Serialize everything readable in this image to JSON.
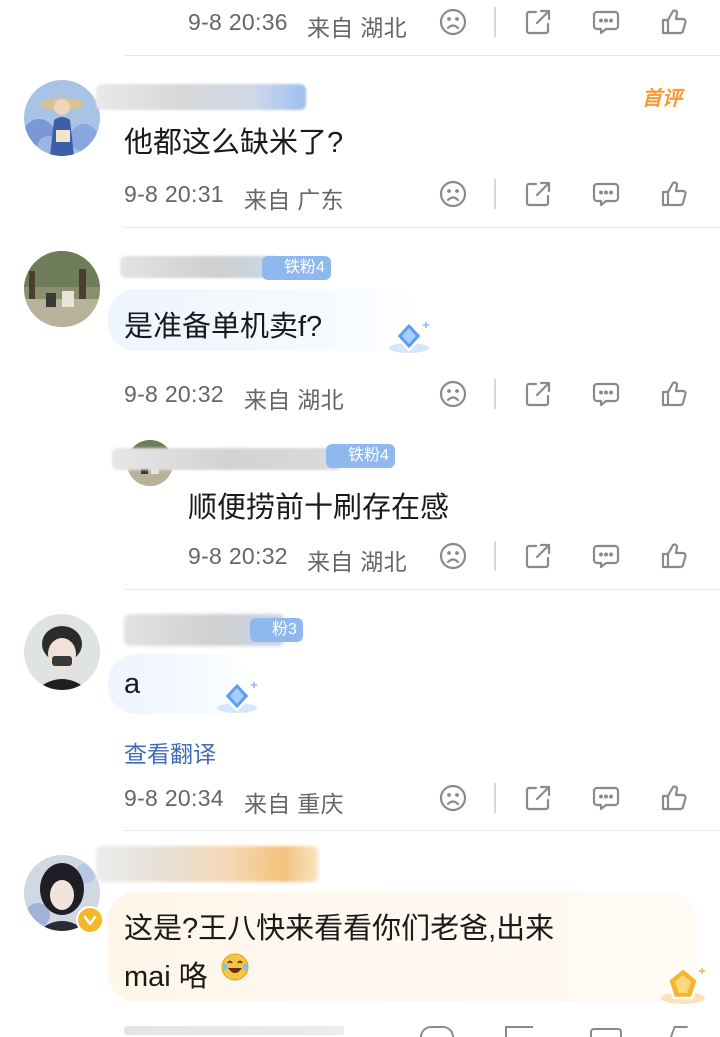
{
  "icons": {
    "dislike": "frown-face-icon",
    "share": "share-icon",
    "comment": "comment-icon",
    "like": "thumbs-up-icon"
  },
  "colors": {
    "meta_text": "#666666",
    "icon_stroke": "#8a8a8a",
    "badge_blue": "#8fb8ef",
    "first_comment_tag": "#f29b38",
    "translate_link": "#3f6eb5",
    "emoji_yellow": "#f6c343"
  },
  "top_meta": {
    "time": "9-8 20:36",
    "location": "来自 湖北"
  },
  "comments": [
    {
      "id": "c1",
      "tag": "首评",
      "text": "他都这么缺米了?",
      "time": "9-8 20:31",
      "location": "来自 广东"
    },
    {
      "id": "c2",
      "badge": "铁粉4",
      "text": "是准备单机卖f?",
      "time": "9-8 20:32",
      "location": "来自 湖北",
      "reply": {
        "badge": "铁粉4",
        "text": "顺便捞前十刷存在感",
        "time": "9-8 20:32",
        "location": "来自 湖北"
      }
    },
    {
      "id": "c3",
      "badge": "粉3",
      "text": "a",
      "translate": "查看翻译",
      "time": "9-8 20:34",
      "location": "来自 重庆"
    },
    {
      "id": "c4",
      "text_line1": "这是?王八快来看看你们老爸,出来",
      "text_line2": "mai 咯"
    }
  ]
}
